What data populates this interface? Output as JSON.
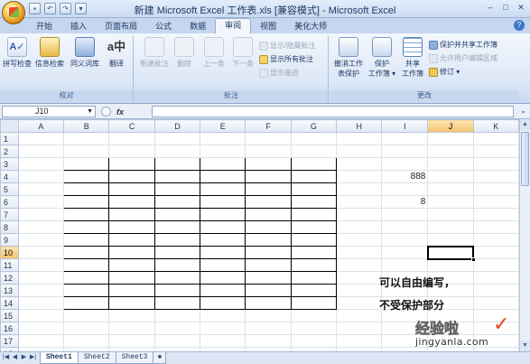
{
  "window": {
    "title": "新建 Microsoft Excel 工作表.xls  [兼容模式] - Microsoft Excel",
    "controls": [
      "–",
      "□",
      "✕"
    ]
  },
  "qat": [
    "save",
    "undo",
    "redo",
    "customize"
  ],
  "tabs": [
    {
      "label": "开始"
    },
    {
      "label": "插入"
    },
    {
      "label": "页面布局"
    },
    {
      "label": "公式"
    },
    {
      "label": "数据"
    },
    {
      "label": "审阅",
      "active": true
    },
    {
      "label": "视图"
    },
    {
      "label": "美化大师"
    }
  ],
  "ribbon": {
    "proofing": {
      "label": "校对",
      "buttons": [
        "拼写检查",
        "信息检索",
        "同义词库",
        "翻译"
      ]
    },
    "comments": {
      "label": "批注",
      "big": [
        "新建批注",
        "删除",
        "上一条",
        "下一条"
      ],
      "small": [
        "显示/隐藏批注",
        "显示所有批注",
        "显示墨迹"
      ]
    },
    "changes": {
      "label": "更改",
      "big": [
        {
          "line1": "撤消工作",
          "line2": "表保护"
        },
        {
          "line1": "保护",
          "line2": "工作簿 ▾"
        },
        {
          "line1": "共享",
          "line2": "工作簿"
        }
      ],
      "small": [
        "保护并共享工作簿",
        "允许用户编辑区域",
        "修订 ▾"
      ]
    }
  },
  "formula_bar": {
    "name_box": "J10",
    "fx": "fx",
    "value": ""
  },
  "columns": [
    "A",
    "B",
    "C",
    "D",
    "E",
    "F",
    "G",
    "H",
    "I",
    "J",
    "K"
  ],
  "rows": [
    "1",
    "2",
    "3",
    "4",
    "5",
    "6",
    "7",
    "8",
    "9",
    "10",
    "11",
    "12",
    "13",
    "14",
    "15",
    "16",
    "17",
    "18"
  ],
  "selected": {
    "col": "J",
    "row": "10"
  },
  "cells": {
    "I4": "888",
    "I6": "8"
  },
  "note": {
    "line1": "可以自由编写，",
    "line2": "不受保护部分"
  },
  "watermark": {
    "big": "经验啦",
    "small": "jingyanla.com"
  },
  "sheets": [
    {
      "label": "Sheet1",
      "active": true
    },
    {
      "label": "Sheet2"
    },
    {
      "label": "Sheet3"
    }
  ]
}
